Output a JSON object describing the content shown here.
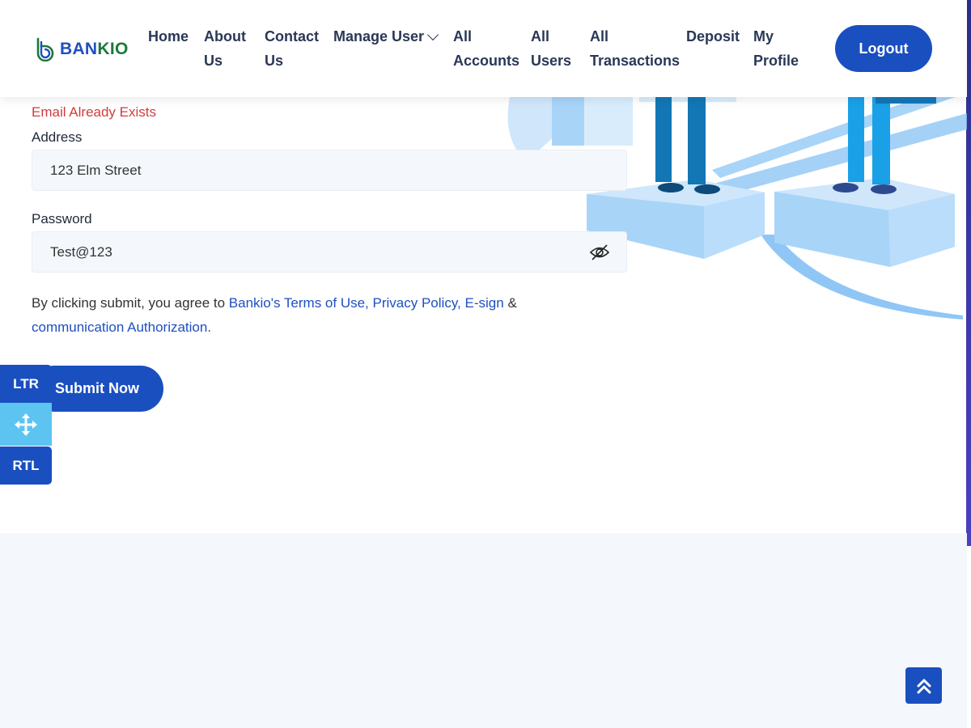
{
  "brand": {
    "name_part1": "BAN",
    "name_part2": "KIO",
    "logo_icon": "bankio-logo-icon"
  },
  "nav": {
    "items": [
      {
        "label_line1": "Home",
        "label_line2": ""
      },
      {
        "label_line1": "About",
        "label_line2": "Us"
      },
      {
        "label_line1": "Contact",
        "label_line2": "Us"
      },
      {
        "label_line1": "Manage User",
        "label_line2": ""
      },
      {
        "label_line1": "All",
        "label_line2": "Accounts"
      },
      {
        "label_line1": "All",
        "label_line2": "Users"
      },
      {
        "label_line1": "All",
        "label_line2": "Transactions"
      },
      {
        "label_line1": "Deposit",
        "label_line2": ""
      },
      {
        "label_line1": "My",
        "label_line2": "Profile"
      }
    ],
    "logout_label": "Logout"
  },
  "form": {
    "email_error": "Email Already Exists",
    "address": {
      "label": "Address",
      "value": "123 Elm Street"
    },
    "password": {
      "label": "Password",
      "value": "Test@123",
      "toggle_icon": "eye-slash-icon"
    },
    "terms": {
      "prefix": "By clicking submit, you agree to ",
      "link_terms": "Bankio's Terms of Use,",
      "link_privacy": "Privacy Policy,",
      "link_esign": "E-sign",
      "amp": "&",
      "link_comm": "communication Authorization."
    },
    "submit_label": "Submit Now"
  },
  "direction_switcher": {
    "ltr_label": "LTR",
    "rtl_label": "RTL",
    "move_icon": "move-arrows-icon"
  },
  "scroll_top_icon": "double-chevron-up-icon",
  "colors": {
    "primary": "#1a4fc0",
    "accent_light": "#5dc4f2",
    "error": "#d23b3b",
    "field_bg": "#f4f8fd"
  }
}
